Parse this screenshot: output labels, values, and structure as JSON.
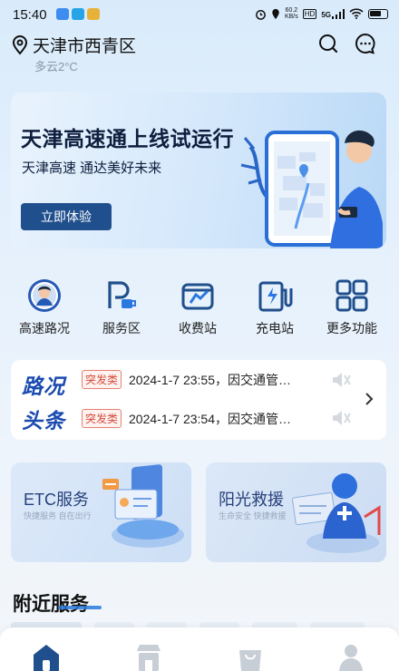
{
  "status": {
    "time": "15:40",
    "net_speed": "60.2",
    "net_unit": "KB/s",
    "hd": "HD",
    "signal": "5G"
  },
  "location": {
    "city": "天津市西青区",
    "weather": "多云2°C"
  },
  "banner": {
    "title": "天津高速通上线试运行",
    "subtitle": "天津高速 通达美好未来",
    "button": "立即体验"
  },
  "quick_actions": [
    {
      "label": "高速路况",
      "icon": "highway-badge-icon"
    },
    {
      "label": "服务区",
      "icon": "service-area-icon"
    },
    {
      "label": "收费站",
      "icon": "toll-station-icon"
    },
    {
      "label": "充电站",
      "icon": "charging-station-icon"
    },
    {
      "label": "更多功能",
      "icon": "grid-icon"
    }
  ],
  "news": {
    "logo_line1": "路况",
    "logo_line2": "头条",
    "items": [
      {
        "tag": "突发类",
        "text": "2024-1-7 23:55，因交通管…"
      },
      {
        "tag": "突发类",
        "text": "2024-1-7 23:54，因交通管…"
      }
    ]
  },
  "cards": [
    {
      "title": "ETC服务",
      "subtitle": "快捷服务 自在出行"
    },
    {
      "title": "阳光救援",
      "subtitle": "生命安全 快捷救援"
    }
  ],
  "nearby": {
    "title": "附近服务"
  },
  "colors": {
    "accent": "#1f4f8c",
    "news_blue": "#1a4bb0",
    "tag_red": "#d24a3a"
  }
}
